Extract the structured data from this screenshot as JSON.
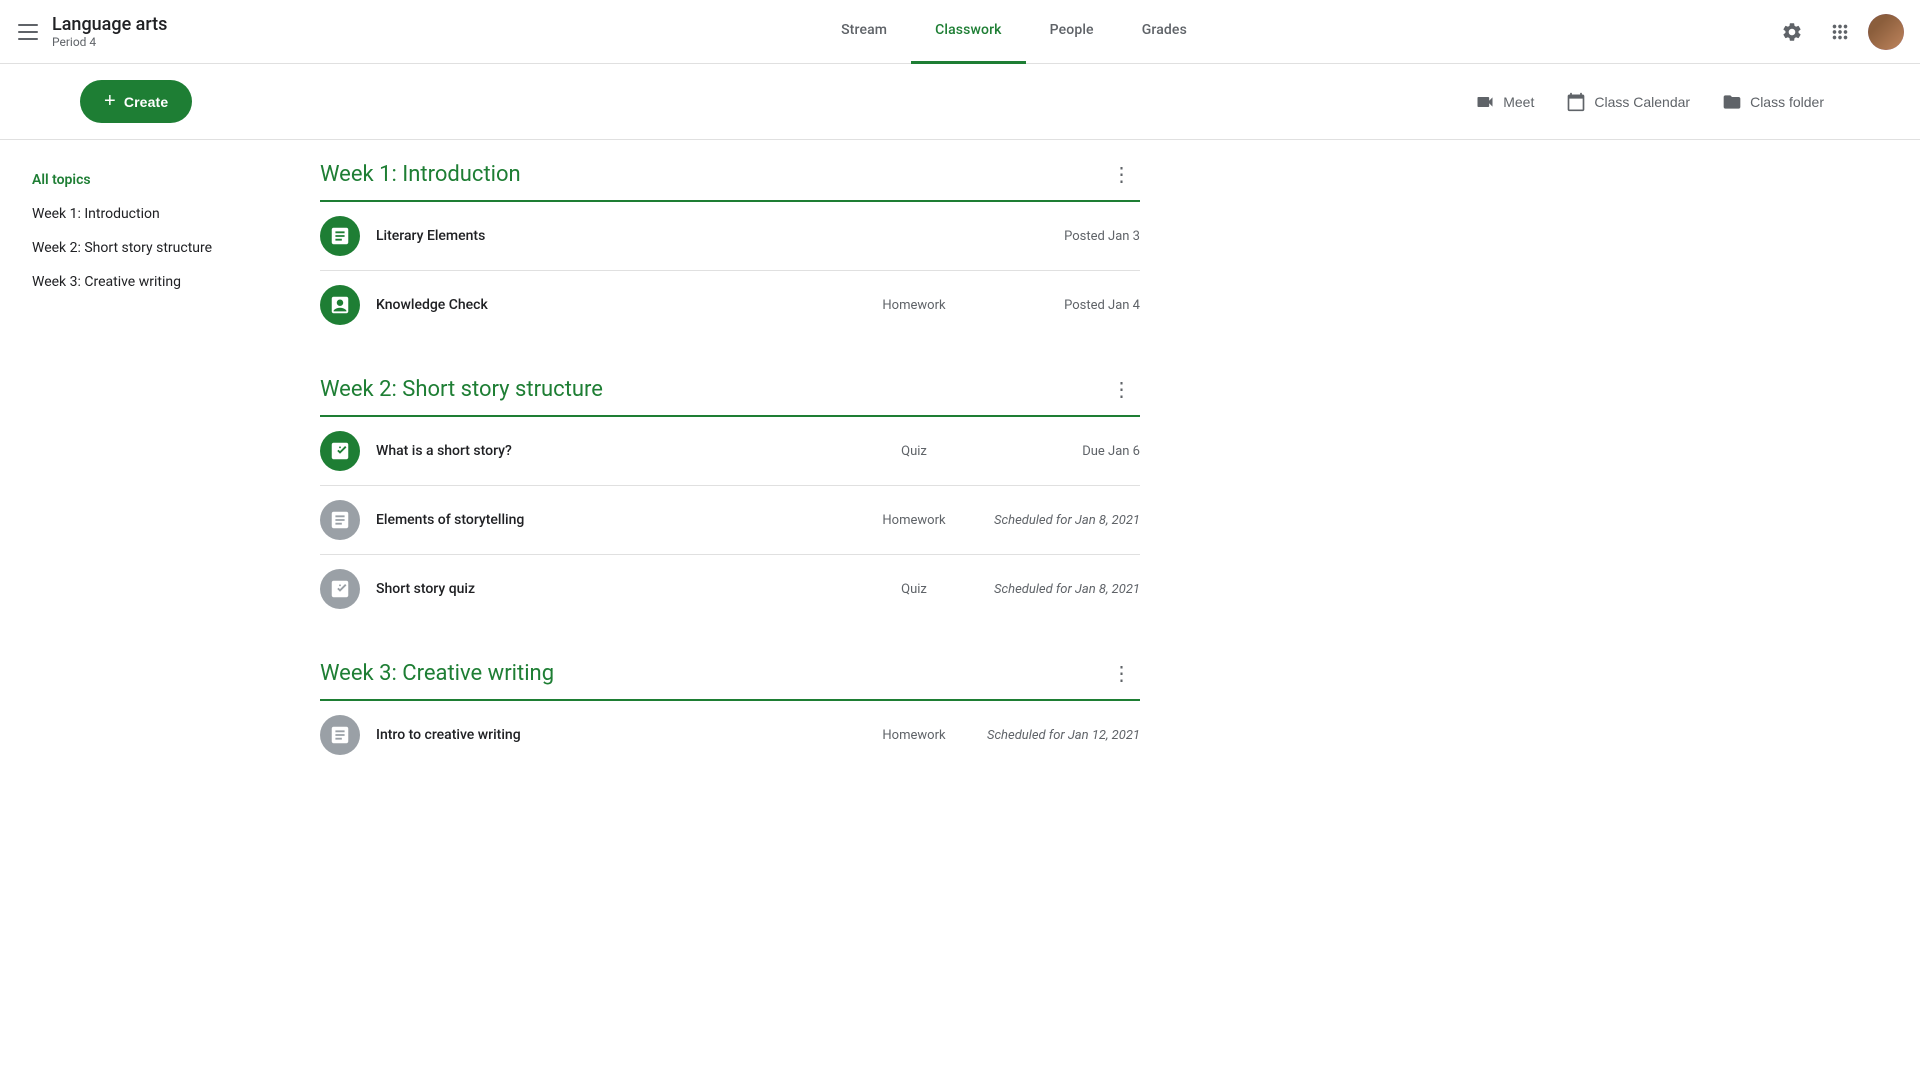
{
  "app": {
    "title": "Language arts",
    "subtitle": "Period 4"
  },
  "nav": {
    "tabs": [
      {
        "id": "stream",
        "label": "Stream",
        "active": false
      },
      {
        "id": "classwork",
        "label": "Classwork",
        "active": true
      },
      {
        "id": "people",
        "label": "People",
        "active": false
      },
      {
        "id": "grades",
        "label": "Grades",
        "active": false
      }
    ]
  },
  "toolbar": {
    "create_label": "Create",
    "meet_label": "Meet",
    "calendar_label": "Class Calendar",
    "folder_label": "Class folder"
  },
  "sidebar": {
    "items": [
      {
        "id": "all-topics",
        "label": "All topics",
        "active": true
      },
      {
        "id": "week1",
        "label": "Week 1: Introduction",
        "active": false
      },
      {
        "id": "week2",
        "label": "Week 2: Short story structure",
        "active": false
      },
      {
        "id": "week3",
        "label": "Week 3: Creative writing",
        "active": false
      }
    ]
  },
  "sections": [
    {
      "id": "week1",
      "title": "Week 1: Introduction",
      "assignments": [
        {
          "id": "literary-elements",
          "name": "Literary Elements",
          "type": "",
          "date": "Posted Jan 3",
          "icon_type": "assignment",
          "icon_color": "green",
          "scheduled": false
        },
        {
          "id": "knowledge-check",
          "name": "Knowledge Check",
          "type": "Homework",
          "date": "Posted Jan 4",
          "icon_type": "quiz",
          "icon_color": "green",
          "scheduled": false
        }
      ]
    },
    {
      "id": "week2",
      "title": "Week 2: Short story structure",
      "assignments": [
        {
          "id": "what-is-short-story",
          "name": "What is a short story?",
          "type": "Quiz",
          "date": "Due Jan 6",
          "icon_type": "quiz",
          "icon_color": "green",
          "scheduled": false
        },
        {
          "id": "elements-storytelling",
          "name": "Elements of storytelling",
          "type": "Homework",
          "date": "Scheduled for Jan 8, 2021",
          "icon_type": "assignment",
          "icon_color": "gray",
          "scheduled": true
        },
        {
          "id": "short-story-quiz",
          "name": "Short story quiz",
          "type": "Quiz",
          "date": "Scheduled for Jan 8, 2021",
          "icon_type": "quiz",
          "icon_color": "gray",
          "scheduled": true
        }
      ]
    },
    {
      "id": "week3",
      "title": "Week 3: Creative writing",
      "assignments": [
        {
          "id": "intro-creative-writing",
          "name": "Intro to creative writing",
          "type": "Homework",
          "date": "Scheduled for Jan 12, 2021",
          "icon_type": "assignment",
          "icon_color": "gray",
          "scheduled": true
        }
      ]
    }
  ]
}
